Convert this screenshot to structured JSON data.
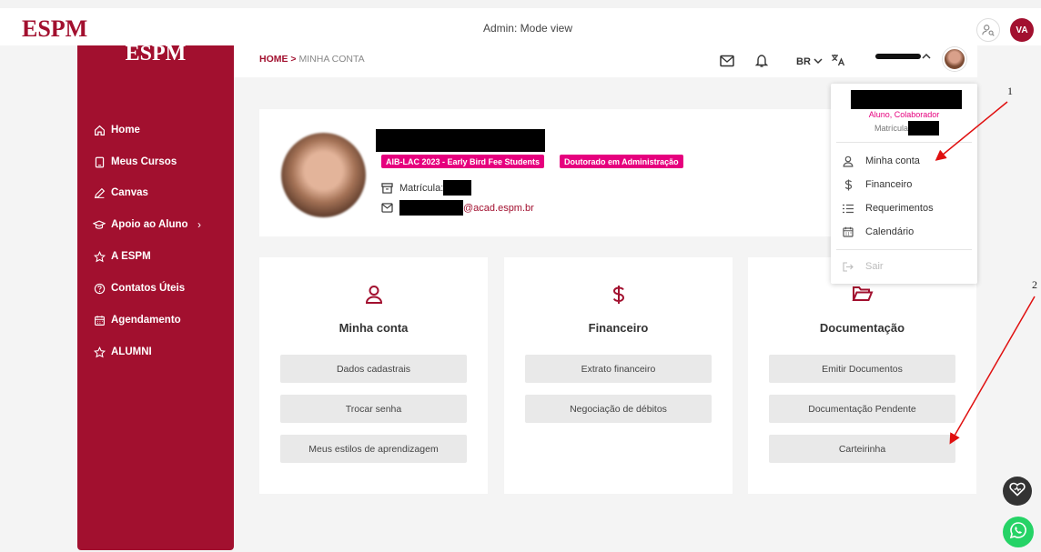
{
  "topbar": {
    "brand": "ESPM",
    "mode_label": "Admin: Mode view",
    "avatar_initials": "VA"
  },
  "sidebar": {
    "logo": "ESPM",
    "items": [
      {
        "label": "Home",
        "icon": "home-icon"
      },
      {
        "label": "Meus Cursos",
        "icon": "tablet-icon"
      },
      {
        "label": "Canvas",
        "icon": "pencil-icon"
      },
      {
        "label": "Apoio ao Aluno",
        "icon": "graduation-cap-icon",
        "has_submenu": true
      },
      {
        "label": "A ESPM",
        "icon": "star-icon"
      },
      {
        "label": "Contatos Úteis",
        "icon": "question-circle-icon"
      },
      {
        "label": "Agendamento",
        "icon": "calendar-icon"
      },
      {
        "label": "ALUMNI",
        "icon": "star-icon"
      }
    ],
    "submenu_chevron": "›"
  },
  "header": {
    "breadcrumb_home": "HOME",
    "breadcrumb_sep": ">",
    "breadcrumb_current": "MINHA CONTA",
    "language": "BR"
  },
  "profile": {
    "chips": [
      "AIB-LAC 2023 - Early Bird Fee Students",
      "Doutorado em Administração"
    ],
    "matricula_label": "Matrícula:",
    "email_suffix": "@acad.espm.br"
  },
  "cards": [
    {
      "title": "Minha conta",
      "icon": "user-icon",
      "buttons": [
        "Dados cadastrais",
        "Trocar senha",
        "Meus estilos de aprendizagem"
      ]
    },
    {
      "title": "Financeiro",
      "icon": "dollar-icon",
      "buttons": [
        "Extrato financeiro",
        "Negociação de débitos"
      ]
    },
    {
      "title": "Documentação",
      "icon": "folder-open-icon",
      "buttons": [
        "Emitir Documentos",
        "Documentação Pendente",
        "Carteirinha"
      ]
    }
  ],
  "dropdown": {
    "roles": "Aluno, Colaborador",
    "matricula_label": "Matrícula",
    "items": [
      {
        "label": "Minha conta",
        "icon": "user-icon"
      },
      {
        "label": "Financeiro",
        "icon": "dollar-icon"
      },
      {
        "label": "Requerimentos",
        "icon": "list-icon"
      },
      {
        "label": "Calendário",
        "icon": "calendar-icon"
      }
    ],
    "logout": {
      "label": "Sair",
      "icon": "logout-icon"
    }
  },
  "annotations": [
    "1",
    "2"
  ],
  "colors": {
    "brand": "#a2102f",
    "chip": "#e6007e",
    "whatsapp": "#25d366"
  }
}
